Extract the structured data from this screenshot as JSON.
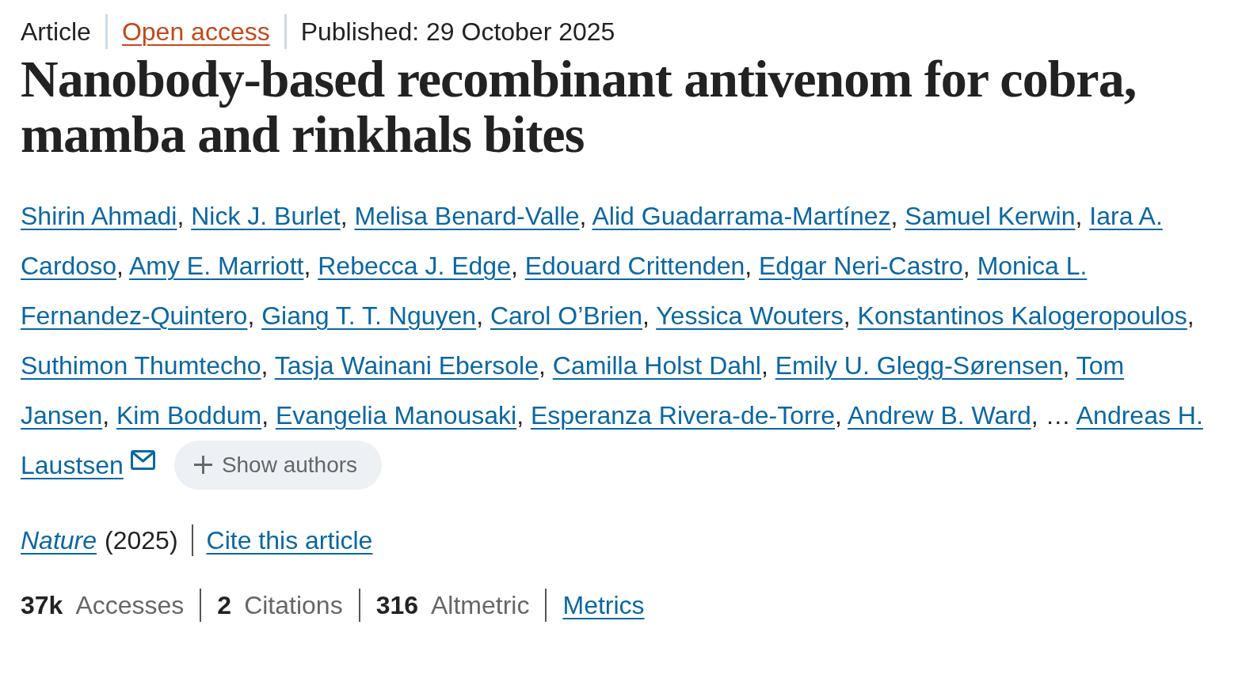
{
  "header": {
    "article_type": "Article",
    "access": "Open access",
    "published": "Published: 29 October 2025"
  },
  "title": "Nanobody-based recombinant antivenom for cobra, mamba and rinkhals bites",
  "authors": [
    {
      "kind": "author",
      "name": "Shirin Ahmadi",
      "email": false
    },
    {
      "kind": "author",
      "name": "Nick J. Burlet",
      "email": false
    },
    {
      "kind": "author",
      "name": "Melisa Benard-Valle",
      "email": false
    },
    {
      "kind": "author",
      "name": "Alid Guadarrama-Martínez",
      "email": false
    },
    {
      "kind": "author",
      "name": "Samuel Kerwin",
      "email": false
    },
    {
      "kind": "author",
      "name": "Iara A. Cardoso",
      "email": false
    },
    {
      "kind": "author",
      "name": "Amy E. Marriott",
      "email": false
    },
    {
      "kind": "author",
      "name": "Rebecca J. Edge",
      "email": false
    },
    {
      "kind": "author",
      "name": "Edouard Crittenden",
      "email": false
    },
    {
      "kind": "author",
      "name": "Edgar Neri-Castro",
      "email": false
    },
    {
      "kind": "author",
      "name": "Monica L. Fernandez-Quintero",
      "email": false
    },
    {
      "kind": "author",
      "name": "Giang T. T. Nguyen",
      "email": false
    },
    {
      "kind": "author",
      "name": "Carol O’Brien",
      "email": false
    },
    {
      "kind": "author",
      "name": "Yessica Wouters",
      "email": false
    },
    {
      "kind": "author",
      "name": "Konstantinos Kalogeropoulos",
      "email": false
    },
    {
      "kind": "author",
      "name": "Suthimon Thumtecho",
      "email": false
    },
    {
      "kind": "author",
      "name": "Tasja Wainani Ebersole",
      "email": false
    },
    {
      "kind": "author",
      "name": "Camilla Holst Dahl",
      "email": false
    },
    {
      "kind": "author",
      "name": "Emily U. Glegg-Sørensen",
      "email": false
    },
    {
      "kind": "author",
      "name": "Tom Jansen",
      "email": false
    },
    {
      "kind": "author",
      "name": "Kim Boddum",
      "email": false
    },
    {
      "kind": "author",
      "name": "Evangelia Manousaki",
      "email": false
    },
    {
      "kind": "author",
      "name": "Esperanza Rivera-de-Torre",
      "email": false
    },
    {
      "kind": "author",
      "name": "Andrew B. Ward",
      "email": false
    },
    {
      "kind": "ellipsis",
      "text": "…"
    },
    {
      "kind": "author",
      "name": "Andreas H. Laustsen",
      "email": true
    }
  ],
  "author_separator": ",",
  "show_authors": {
    "label": "Show authors"
  },
  "citation": {
    "journal": "Nature",
    "year": "(2025)",
    "cite_link": "Cite this article"
  },
  "metrics": {
    "items": [
      {
        "count": "37k",
        "name": "Accesses"
      },
      {
        "count": "2",
        "name": "Citations"
      },
      {
        "count": "316",
        "name": "Altmetric"
      }
    ],
    "link": "Metrics"
  }
}
